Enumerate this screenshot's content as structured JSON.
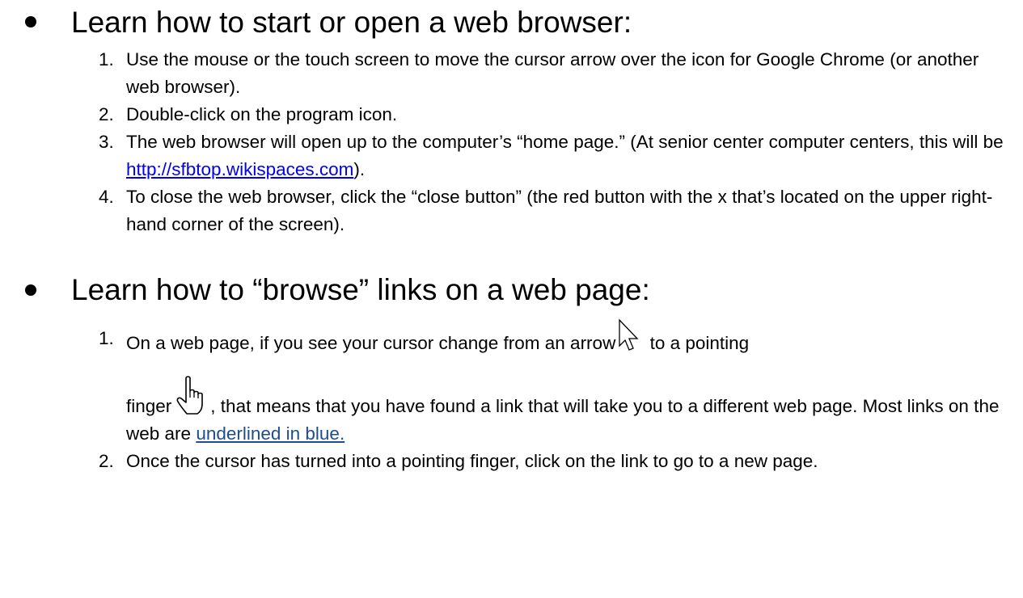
{
  "section1": {
    "heading": "Learn how to start or open a web browser:",
    "steps": [
      {
        "num": "1.",
        "text": "Use the mouse or the touch screen to move the cursor arrow over the icon for Google Chrome (or another web browser)."
      },
      {
        "num": "2.",
        "text": "Double-click on the program icon."
      },
      {
        "num": "3.",
        "text_before": "The web browser will open up to the computer’s “home page.” (At senior center computer centers, this will be ",
        "link": "http://sfbtop.wikispaces.com",
        "text_after": ")."
      },
      {
        "num": "4.",
        "text": "To close the web browser, click the “close button” (the red button with the x that’s located on the upper right-hand corner of the screen)."
      }
    ]
  },
  "section2": {
    "heading": "Learn how to “browse” links on a web page:",
    "steps": [
      {
        "num": "1.",
        "text_a": "On a web page, if you see your cursor change from an arrow",
        "text_b": " to a pointing",
        "text_c": "finger",
        "text_d": ", that means that you have found a link that will take you to a different web page. Most links on the web are ",
        "link": "underlined in blue."
      },
      {
        "num": "2.",
        "text": "Once the cursor has turned into a pointing finger, click on the link to go to a new page."
      }
    ]
  },
  "icons": {
    "arrow": "arrow-cursor-icon",
    "hand": "pointing-hand-cursor-icon"
  }
}
